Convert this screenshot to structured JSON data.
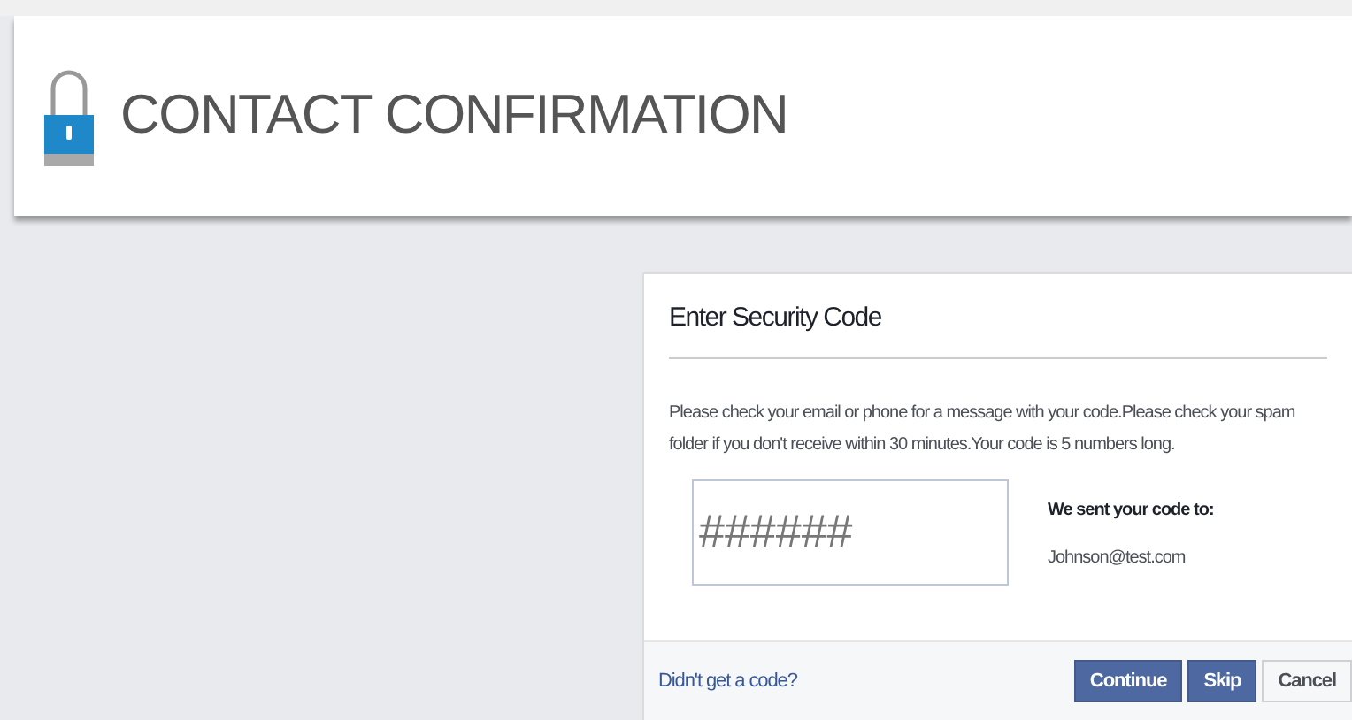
{
  "header": {
    "title": "CONTACT CONFIRMATION"
  },
  "dialog": {
    "title": "Enter Security Code",
    "message": "Please check your email or phone for a message with your code.Please check your spam folder if you don't receive within 30 minutes.Your code is 5 numbers long.",
    "code_field": {
      "placeholder": "######"
    },
    "sent_label": "We sent your code to:",
    "sent_to": "Johnson@test.com",
    "help_link": "Didn't get a code?",
    "buttons": [
      {
        "label": "Continue",
        "kind": "primary"
      },
      {
        "label": "Skip",
        "kind": "primary"
      },
      {
        "label": "Cancel",
        "kind": "secondary"
      }
    ]
  }
}
